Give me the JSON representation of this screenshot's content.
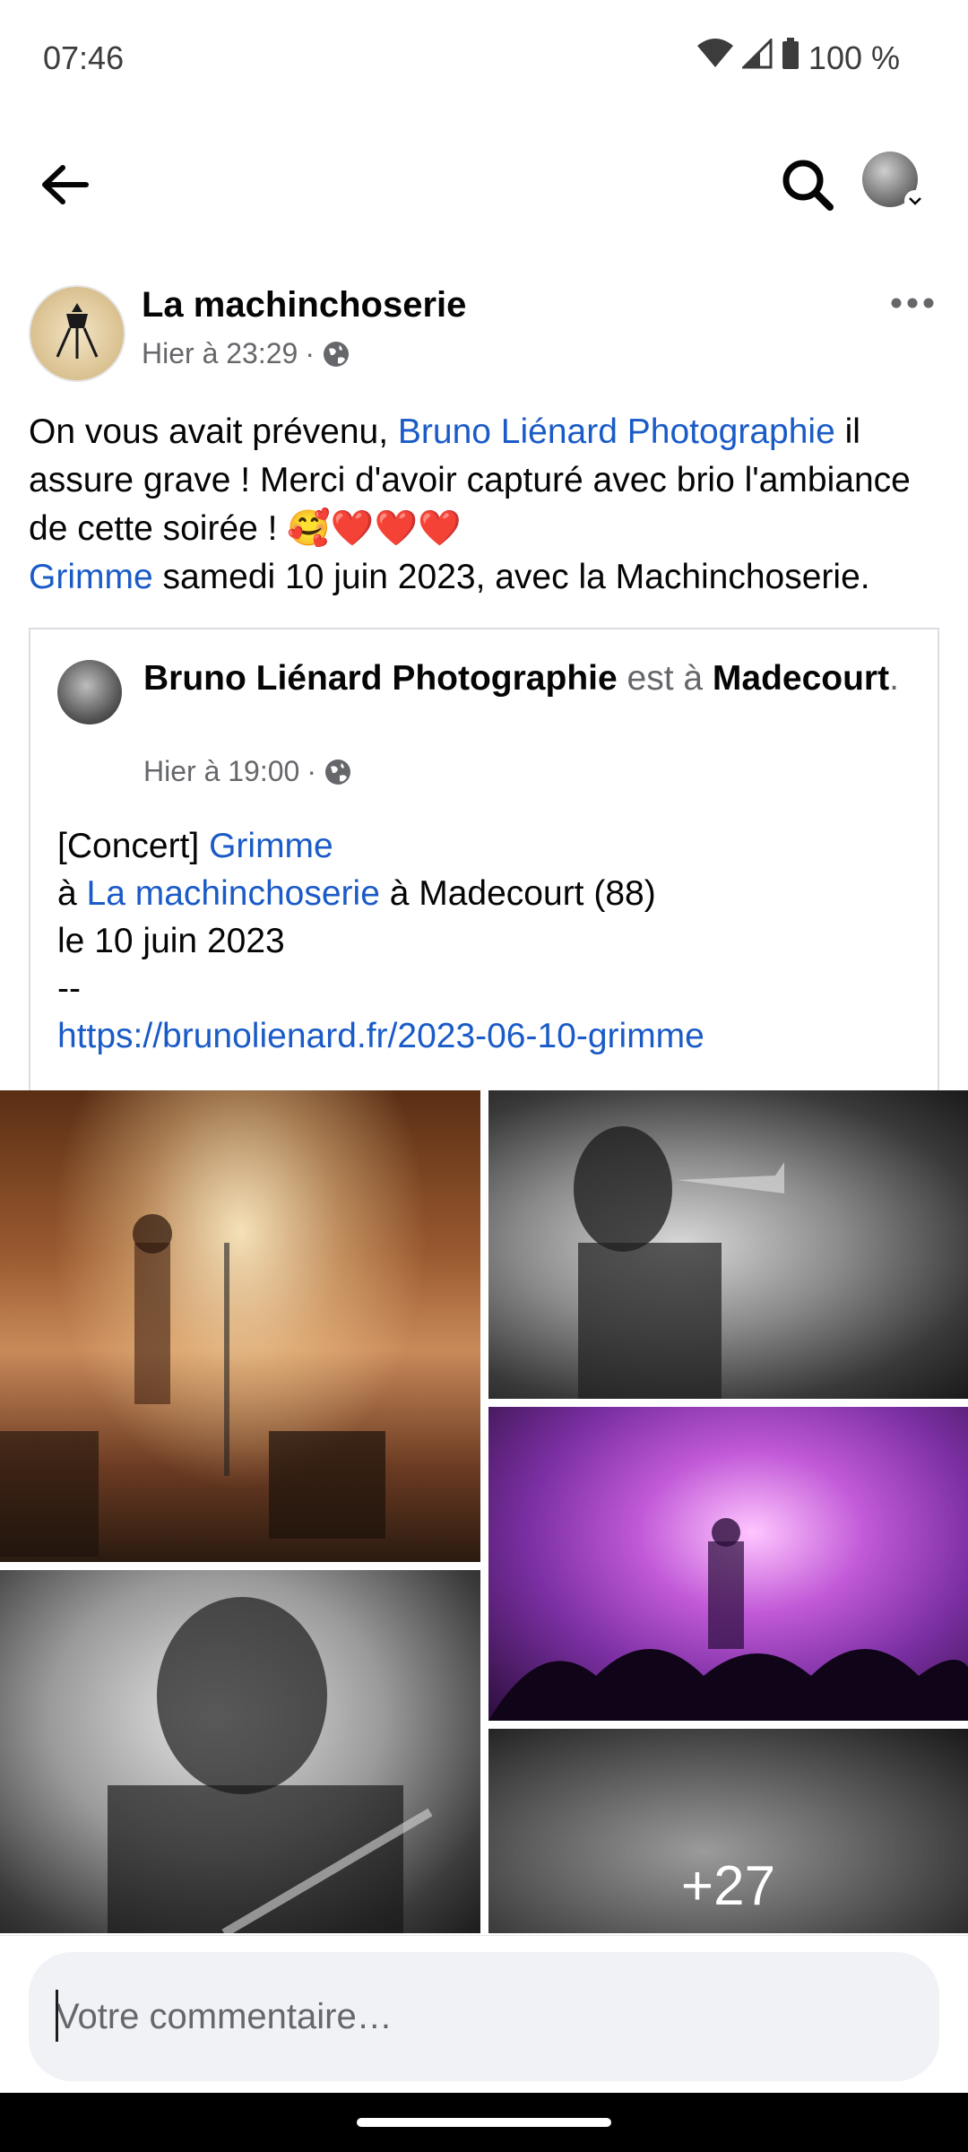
{
  "status_bar": {
    "time": "07:46",
    "battery": "100 %"
  },
  "post": {
    "page_name": "La machinchoserie",
    "timestamp": "Hier à 23:29",
    "separator": "·",
    "text_part1": "On vous avait prévenu, ",
    "text_link1": "Bruno Liénard Photographie",
    "text_part2": " il assure grave ! Merci d'avoir capturé avec brio l'ambiance de cette soirée ! 🥰❤️❤️❤️",
    "text_link2": "Grimme",
    "text_part3": " samedi 10 juin 2023, avec la Machinchoserie."
  },
  "shared": {
    "author": "Bruno Liénard Photographie",
    "is_at": " est à ",
    "location": "Madecourt",
    "period": ".",
    "timestamp": "Hier à 19:00",
    "separator": "·",
    "line1_prefix": "[Concert] ",
    "line1_link": "Grimme",
    "line2_prefix": "à ",
    "line2_link": "La machinchoserie",
    "line2_suffix": " à Madecourt (88)",
    "line3": "le 10 juin 2023",
    "line4": "--",
    "url": "https://brunolienard.fr/2023-06-10-grimme"
  },
  "photos": {
    "more_count": "+27"
  },
  "comment": {
    "placeholder": "Votre commentaire…"
  },
  "colors": {
    "link": "#1a5bc7",
    "meta": "#65676b",
    "input_bg": "#f0f2f5"
  }
}
